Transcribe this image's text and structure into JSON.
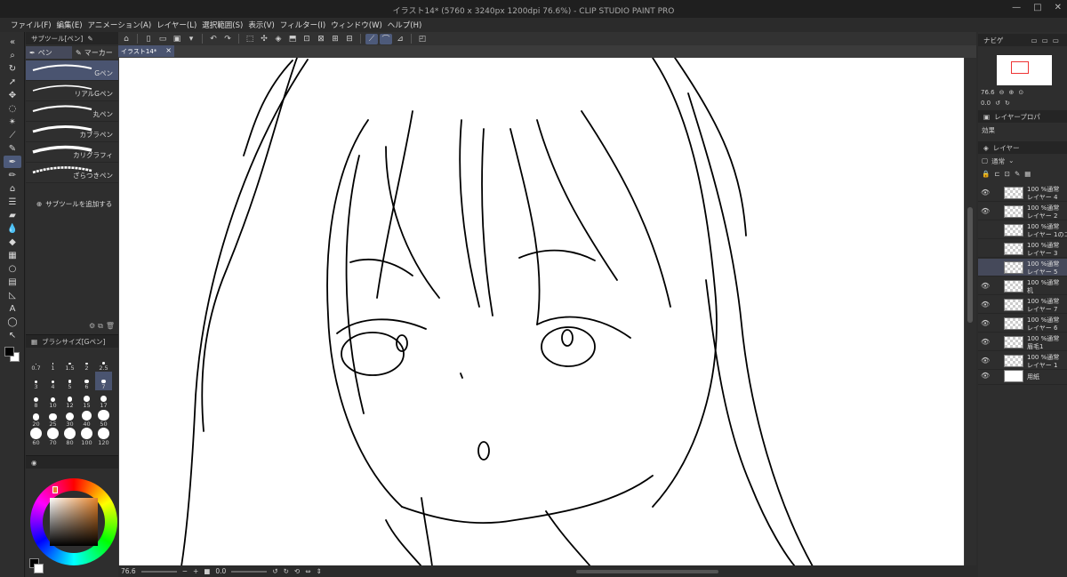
{
  "window": {
    "title": "イラスト14* (5760 x 3240px 1200dpi 76.6%) - CLIP STUDIO PAINT PRO",
    "buttons": [
      "—",
      "□",
      "✕"
    ]
  },
  "menu": [
    "ファイル(F)",
    "編集(E)",
    "アニメーション(A)",
    "レイヤー(L)",
    "選択範囲(S)",
    "表示(V)",
    "フィルター(I)",
    "ウィンドウ(W)",
    "ヘルプ(H)"
  ],
  "subtool_panel": {
    "tab_label": "サブツール[ペン]",
    "groups": [
      "ペン",
      "マーカー"
    ],
    "brushes": [
      "Gペン",
      "リアルGペン",
      "丸ペン",
      "カブラペン",
      "カリグラフィ",
      "ざらつきペン"
    ],
    "selected": "Gペン",
    "add_label": "サブツールを追加する"
  },
  "brush_size_panel": {
    "tab_label": "ブラシサイズ[Gペン]",
    "sizes": [
      "0.7",
      "1",
      "1.5",
      "2",
      "2.5",
      "3",
      "4",
      "5",
      "6",
      "7",
      "8",
      "10",
      "12",
      "15",
      "17",
      "20",
      "25",
      "30",
      "40",
      "50",
      "60",
      "70",
      "80",
      "100",
      "120"
    ],
    "selected": "7"
  },
  "colors": {
    "main": "#000000",
    "sub": "#ffffff",
    "hue": "#e5832a",
    "accent": "#4a5470"
  },
  "document_tab": "イラスト14*",
  "statusbar": {
    "zoom": "76.6",
    "rotation": "0.0"
  },
  "navigator": {
    "tab_label": "ナビゲ",
    "zoom": "76.6",
    "rotation": "0.0"
  },
  "layer_property": {
    "tab_label": "レイヤープロパ",
    "effect_label": "効果"
  },
  "layers_panel": {
    "tab_label": "レイヤー",
    "blend_mode": "通常",
    "layers": [
      {
        "mode": "100 %通常",
        "name": "レイヤー 4",
        "visible": true,
        "selected": false
      },
      {
        "mode": "100 %通常",
        "name": "レイヤー 2",
        "visible": true,
        "selected": false
      },
      {
        "mode": "100 %通常",
        "name": "レイヤー 1のコ",
        "visible": false,
        "selected": false
      },
      {
        "mode": "100 %通常",
        "name": "レイヤー 3",
        "visible": false,
        "selected": false
      },
      {
        "mode": "100 %通常",
        "name": "レイヤー 5",
        "visible": false,
        "selected": true
      },
      {
        "mode": "100 %通常",
        "name": "机",
        "visible": true,
        "selected": false
      },
      {
        "mode": "100 %通常",
        "name": "レイヤー 7",
        "visible": true,
        "selected": false
      },
      {
        "mode": "100 %通常",
        "name": "レイヤー 6",
        "visible": true,
        "selected": false
      },
      {
        "mode": "100 %通常",
        "name": "眉毛1",
        "visible": true,
        "selected": false
      },
      {
        "mode": "100 %通常",
        "name": "レイヤー 1",
        "visible": true,
        "selected": false
      }
    ],
    "paper_label": "用紙"
  }
}
